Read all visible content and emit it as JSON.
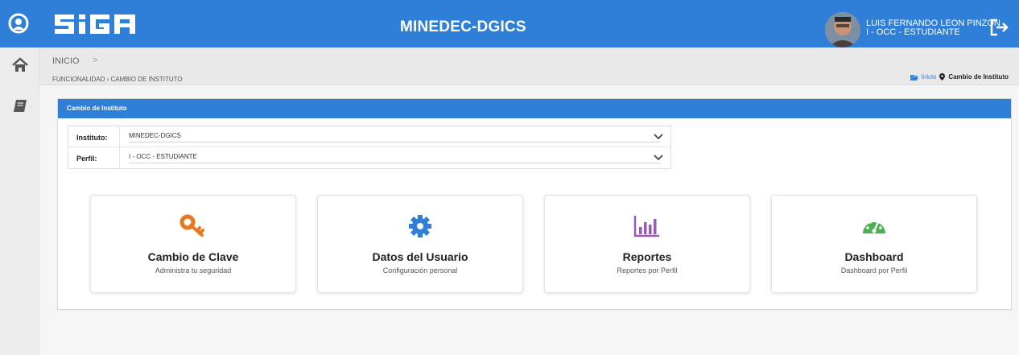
{
  "header": {
    "app_name": "SIGA",
    "center_title": "MINEDEC-DGICS",
    "user_name": "LUIS FERNANDO LEON PINZON",
    "user_role": "I - OCC - ESTUDIANTE"
  },
  "breadcrumb": {
    "root": "INICIO",
    "chevron": ">",
    "functionality": "FUNCIONALIDAD › CAMBIO DE INSTITUTO",
    "right_link": "Inicio",
    "right_current": "Cambio de Instituto"
  },
  "panel": {
    "title": "Cambio de Instituto",
    "fields": [
      {
        "label": "Instituto:",
        "value": "MINEDEC-DGICS"
      },
      {
        "label": "Perfil:",
        "value": "I - OCC - ESTUDIANTE"
      }
    ]
  },
  "cards": [
    {
      "title": "Cambio de Clave",
      "subtitle": "Administra tu seguridad",
      "icon": "key-icon",
      "color": "#e8781e"
    },
    {
      "title": "Datos del Usuario",
      "subtitle": "Configuración personal",
      "icon": "gear-icon",
      "color": "#2f7fd9"
    },
    {
      "title": "Reportes",
      "subtitle": "Reportes por Perfil",
      "icon": "bar-chart-icon",
      "color": "#9b59b6"
    },
    {
      "title": "Dashboard",
      "subtitle": "Dashboard por Perfil",
      "icon": "speedometer-icon",
      "color": "#4caf50"
    }
  ],
  "colors": {
    "primary": "#2f7fd9",
    "background": "#f5f5f5"
  }
}
